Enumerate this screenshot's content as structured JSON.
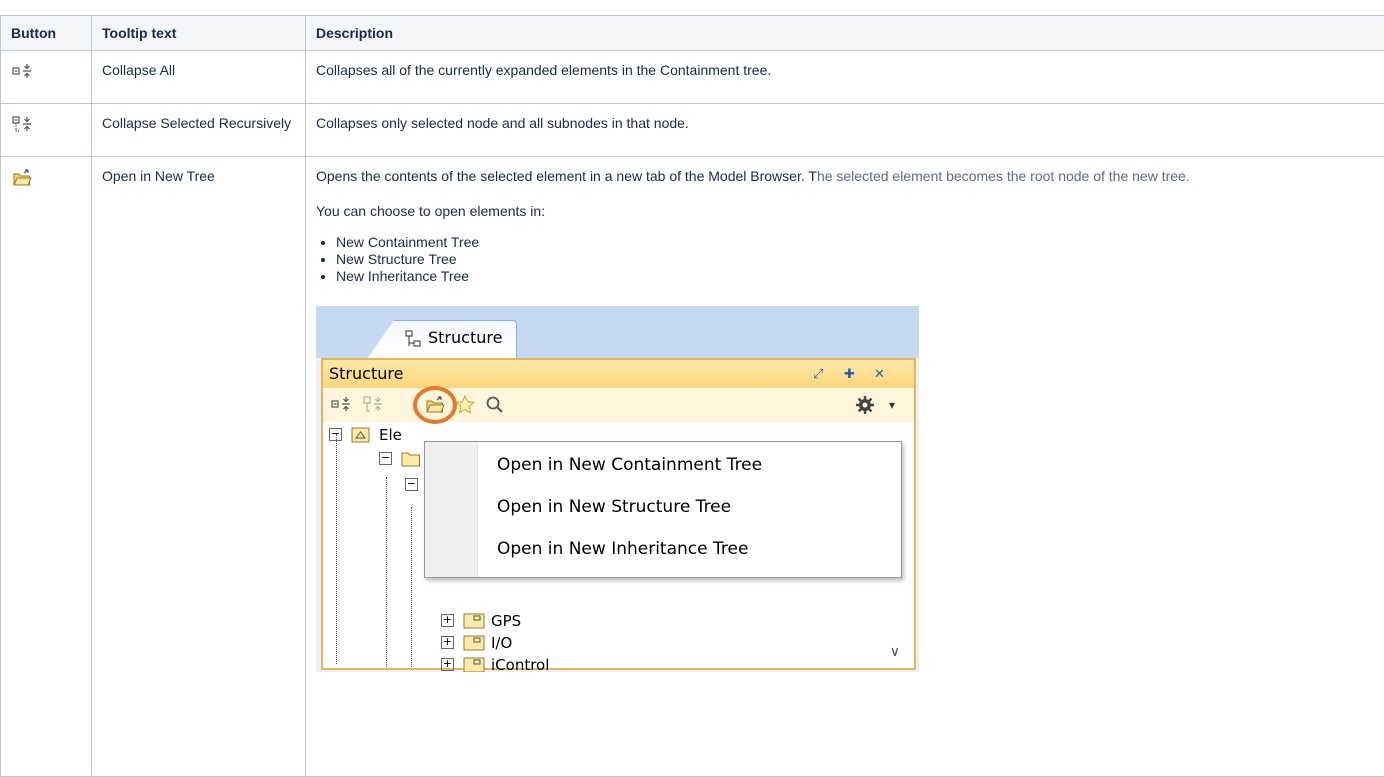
{
  "table": {
    "headers": [
      "Button",
      "Tooltip text",
      "Description"
    ],
    "rows": [
      {
        "icon": "collapse-all-icon",
        "tooltip": "Collapse All",
        "description": "Collapses all of the currently expanded elements in the Containment tree."
      },
      {
        "icon": "collapse-selected-recursively-icon",
        "tooltip": "Collapse Selected Recursively",
        "description": "Collapses only selected node and all subnodes in that node."
      },
      {
        "icon": "open-folder-icon",
        "tooltip": "Open in New Tree",
        "description_a": "Opens the contents of the selected element in a new tab of the Model Browser. T",
        "description_b": "he selected element becomes the root node of the new tree.",
        "choose_text": "You can choose to open elements in:",
        "options": [
          "New Containment Tree",
          "New Structure Tree",
          "New Inheritance Tree"
        ]
      }
    ]
  },
  "screenshot": {
    "tab_label": "Structure",
    "panel_title": "Structure",
    "header_controls": [
      "restore-icon",
      "pin-icon",
      "close-icon"
    ],
    "tree_items": [
      "Ele",
      "GPS",
      "I/O",
      "iControl"
    ],
    "menu_items": [
      "Open in New Containment Tree",
      "Open in New Structure Tree",
      "Open in New Inheritance Tree"
    ],
    "colors": {
      "highlight_ring": "#e8762b",
      "panel_border": "#e7b653",
      "tab_strip": "#c5daf1"
    }
  }
}
